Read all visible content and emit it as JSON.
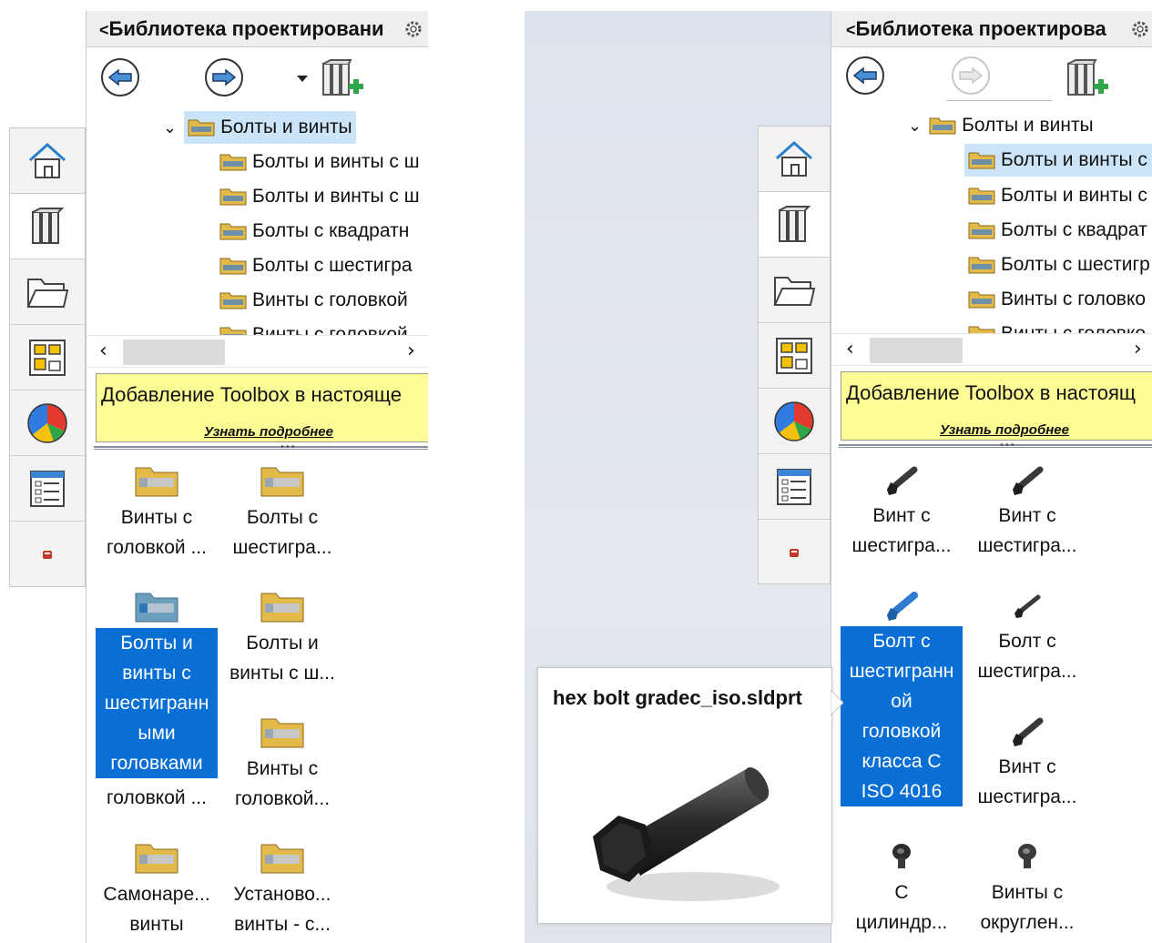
{
  "sidebar_tabs": [
    "home-icon",
    "design-library-icon",
    "file-explorer-icon",
    "view-palette-icon",
    "appearances-icon",
    "custom-properties-icon",
    "solidworks-forum-icon"
  ],
  "left": {
    "title": "Библиотека проектировани",
    "tree": {
      "root": "Болты и винты",
      "children": [
        "Болты и винты с ш",
        "Болты и винты с ш",
        "Болты с квадратн",
        "Болты с шестигра",
        "Винты с головкой",
        "Винты с головкой"
      ]
    },
    "banner": {
      "text": "Добавление Toolbox в настояще",
      "link": "Узнать подробнее"
    },
    "items": [
      {
        "lines": [
          "Винты с",
          "головкой ..."
        ]
      },
      {
        "lines": [
          "Болты с",
          "шестигра..."
        ]
      },
      {
        "lines": [
          "Болты и",
          "винты с",
          "шестигранн",
          "ыми",
          "головками"
        ],
        "selected": true
      },
      {
        "lines": [
          "Болты и",
          "винты с ш..."
        ]
      },
      {
        "lines": [
          "Винты с",
          "головкой..."
        ]
      },
      {
        "lines": [
          "головкой ..."
        ]
      },
      {
        "lines": [
          "Самонаре...",
          "винты"
        ]
      },
      {
        "lines": [
          "Установо...",
          "винты - с..."
        ]
      }
    ]
  },
  "right": {
    "title": "Библиотека проектирова",
    "tree": {
      "root": "Болты и винты",
      "children": [
        "Болты и винты с",
        "Болты и винты с",
        "Болты с квадрат",
        "Болты с шестигр",
        "Винты с головко",
        "Винты с головко"
      ]
    },
    "banner": {
      "text": "Добавление Toolbox в настоящ",
      "link": "Узнать подробнее"
    },
    "items": [
      {
        "lines": [
          "Винт с",
          "шестигра..."
        ]
      },
      {
        "lines": [
          "Винт с",
          "шестигра..."
        ]
      },
      {
        "lines": [
          "Болт с",
          "шестигранн",
          "ой",
          "головкой",
          "класса С",
          "ISO 4016"
        ],
        "selected": true
      },
      {
        "lines": [
          "Болт с",
          "шестигра..."
        ]
      },
      {
        "lines": [
          "Винт с",
          "шестигра..."
        ]
      },
      {
        "lines": [
          "С",
          "цилиндр..."
        ]
      },
      {
        "lines": [
          "Винты с",
          "округлен..."
        ]
      }
    ]
  },
  "tooltip": {
    "title": "hex bolt gradec_iso.sldprt"
  }
}
